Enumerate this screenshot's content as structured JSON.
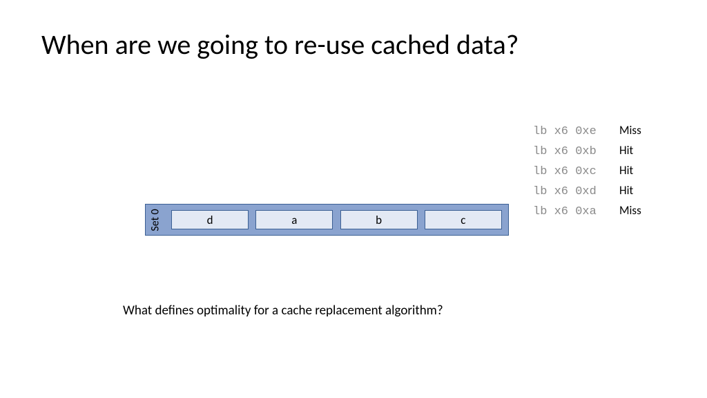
{
  "title": "When are we going to re-use cached data?",
  "cache": {
    "set_label": "Set 0",
    "blocks": [
      "d",
      "a",
      "b",
      "c"
    ]
  },
  "trace": [
    {
      "instr": "lb x6 0xe",
      "result": "Miss"
    },
    {
      "instr": "lb x6 0xb",
      "result": "Hit"
    },
    {
      "instr": "lb x6 0xc",
      "result": "Hit"
    },
    {
      "instr": "lb x6 0xd",
      "result": "Hit"
    },
    {
      "instr": "lb x6 0xa",
      "result": "Miss"
    }
  ],
  "question": "What defines optimality for a cache replacement algorithm?"
}
